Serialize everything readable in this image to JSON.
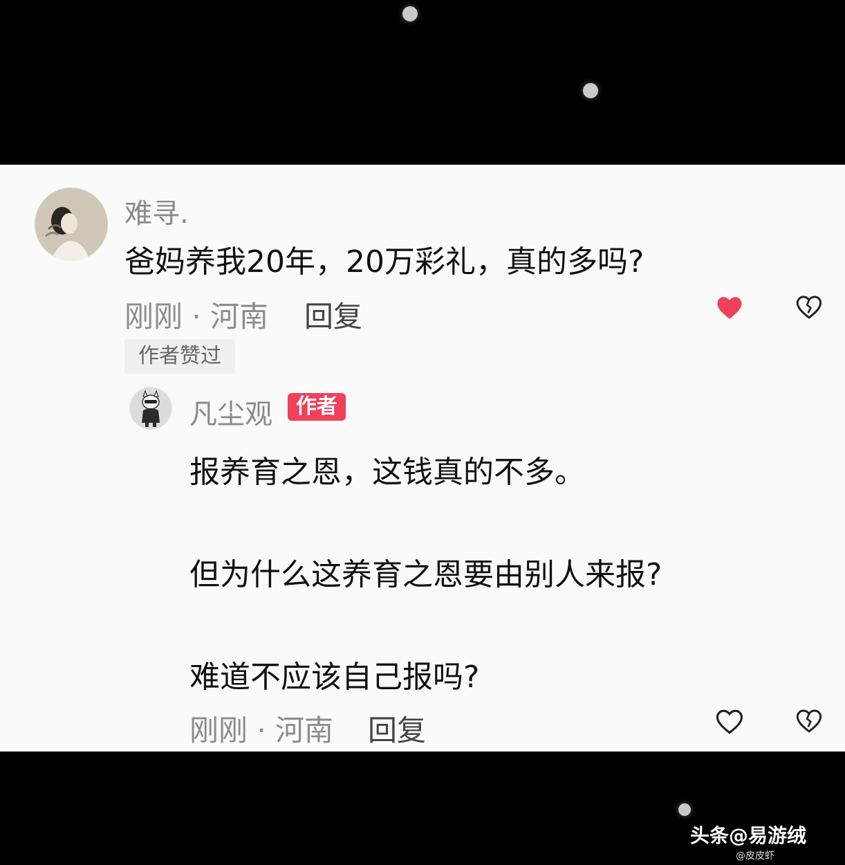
{
  "comment": {
    "username": "难寻.",
    "content": "爸妈养我20年，20万彩礼，真的多吗?",
    "meta": "刚刚 · 河南",
    "reply_label": "回复",
    "liked_by_author": "作者赞过",
    "liked": true
  },
  "reply": {
    "username": "凡尘观",
    "badge": "作者",
    "lines": [
      "报养育之恩，这钱真的不多。",
      "但为什么这养育之恩要由别人来报?",
      "难道不应该自己报吗?"
    ],
    "meta": "刚刚 · 河南",
    "reply_label": "回复",
    "liked": false
  },
  "watermark": {
    "main": "头条@易游绒",
    "sub": "@皮皮虾"
  },
  "colors": {
    "like_active": "#f0405a",
    "badge": "#f0405a",
    "panel_bg": "#fafafa"
  },
  "icons": {
    "like": "heart-icon",
    "dislike": "broken-heart-icon"
  }
}
